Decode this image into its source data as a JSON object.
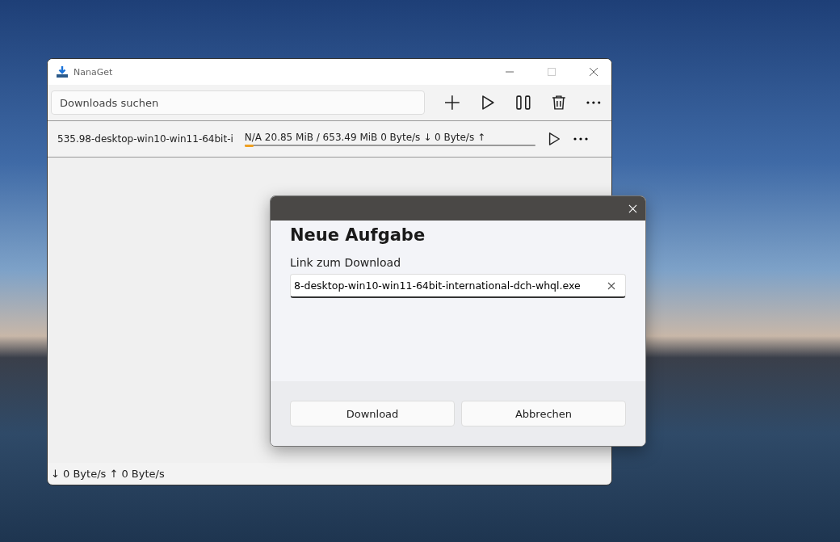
{
  "window": {
    "title": "NanaGet"
  },
  "search": {
    "placeholder": "Downloads suchen"
  },
  "downloads": [
    {
      "name": "535.98-desktop-win10-win11-64bit-i",
      "status": "N/A 20.85 MiB / 653.49 MiB 0 Byte/s ↓ 0 Byte/s ↑",
      "level": 0.03
    }
  ],
  "status_bar": "↓ 0 Byte/s ↑ 0 Byte/s",
  "dialog": {
    "title": "Neue Aufgabe",
    "label": "Link zum Download",
    "value": "8-desktop-win10-win11-64bit-international-dch-whql.exe",
    "buttons": [
      "Download",
      "Abbrechen"
    ]
  }
}
